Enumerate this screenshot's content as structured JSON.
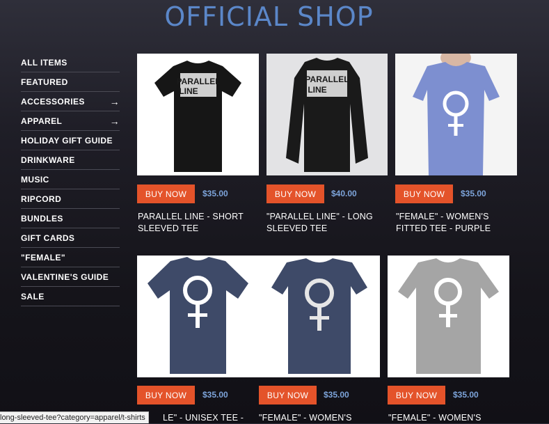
{
  "header": {
    "title": "OFFICIAL SHOP"
  },
  "sidebar": {
    "items": [
      {
        "label": "ALL ITEMS",
        "arrow": ""
      },
      {
        "label": "FEATURED",
        "arrow": ""
      },
      {
        "label": "ACCESSORIES",
        "arrow": "→"
      },
      {
        "label": "APPAREL",
        "arrow": "→"
      },
      {
        "label": "HOLIDAY GIFT GUIDE",
        "arrow": ""
      },
      {
        "label": "DRINKWARE",
        "arrow": ""
      },
      {
        "label": "MUSIC",
        "arrow": ""
      },
      {
        "label": "RIPCORD",
        "arrow": ""
      },
      {
        "label": "BUNDLES",
        "arrow": ""
      },
      {
        "label": "GIFT CARDS",
        "arrow": ""
      },
      {
        "label": "\"FEMALE\"",
        "arrow": ""
      },
      {
        "label": "VALENTINE'S GUIDE",
        "arrow": ""
      },
      {
        "label": "SALE",
        "arrow": ""
      }
    ]
  },
  "products": [
    {
      "buy_label": "BUY NOW",
      "price": "$35.00",
      "title_line1": "PARALLEL LINE - SHORT",
      "title_line2": "SLEEVED TEE",
      "shirt_color": "#161616",
      "print": "PARALLEL\nLINE"
    },
    {
      "buy_label": "BUY NOW",
      "price": "$40.00",
      "title_line1": "\"PARALLEL LINE\" - LONG",
      "title_line2": "SLEEVED TEE",
      "shirt_color": "#1a1a1a",
      "print": "PARALLEL\nLINE"
    },
    {
      "buy_label": "BUY NOW",
      "price": "$35.00",
      "title_line1": "\"FEMALE\" - WOMEN'S",
      "title_line2": "FITTED TEE - PURPLE",
      "shirt_color": "#7d8fd0"
    },
    {
      "buy_label": "BUY NOW",
      "price": "$35.00",
      "title_line1": "LE\" - UNISEX TEE -",
      "title_line2": "",
      "shirt_color": "#3e4a68"
    },
    {
      "buy_label": "BUY NOW",
      "price": "$35.00",
      "title_line1": "\"FEMALE\" - WOMEN'S",
      "title_line2": "",
      "shirt_color": "#3e4a68"
    },
    {
      "buy_label": "BUY NOW",
      "price": "$35.00",
      "title_line1": "\"FEMALE\" - WOMEN'S",
      "title_line2": "",
      "shirt_color": "#a5a5a5"
    }
  ],
  "status_bar": {
    "text": "long-sleeved-tee?category=apparel/t-shirts"
  },
  "colors": {
    "accent": "#e4532a",
    "price": "#7da4da",
    "title": "#5b87c9"
  }
}
